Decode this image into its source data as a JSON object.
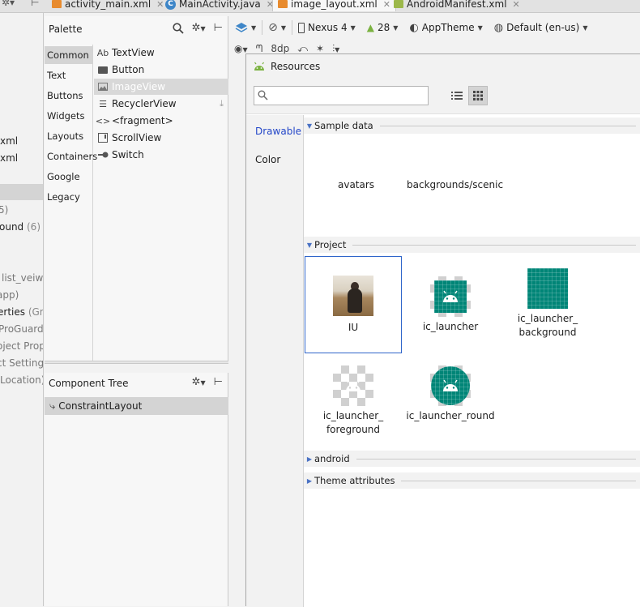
{
  "tabs": [
    {
      "label": "activity_main.xml",
      "icon": "layout-file-icon"
    },
    {
      "label": "MainActivity.java",
      "icon": "class-icon"
    },
    {
      "label": "image_layout.xml",
      "icon": "layout-file-icon",
      "active": true
    },
    {
      "label": "AndroidManifest.xml",
      "icon": "manifest-icon"
    }
  ],
  "left_tree": {
    "items": [
      "xml",
      "xml",
      "5)",
      "ound",
      "(6)",
      "list_veiw)",
      "app)",
      "erties",
      "(Grad",
      "ProGuard R",
      "oject Prope",
      "ct Settings",
      "Location)"
    ]
  },
  "palette": {
    "title": "Palette",
    "categories": [
      "Common",
      "Text",
      "Buttons",
      "Widgets",
      "Layouts",
      "Containers",
      "Google",
      "Legacy"
    ],
    "selected_category": "Common",
    "items": [
      {
        "label": "TextView",
        "icon": "Ab"
      },
      {
        "label": "Button",
        "icon": "button-icon"
      },
      {
        "label": "ImageView",
        "icon": "image-icon"
      },
      {
        "label": "RecyclerView",
        "icon": "list-icon"
      },
      {
        "label": "<fragment>",
        "icon": "<>"
      },
      {
        "label": "ScrollView",
        "icon": "scroll-icon"
      },
      {
        "label": "Switch",
        "icon": "switch-icon"
      }
    ],
    "selected_item": "ImageView"
  },
  "component_tree": {
    "title": "Component Tree",
    "root": "ConstraintLayout"
  },
  "design_toolbar": {
    "device": "Nexus 4",
    "api": "28",
    "theme": "AppTheme",
    "locale": "Default (en-us)",
    "margin": "8dp"
  },
  "resources": {
    "title": "Resources",
    "search_placeholder": "",
    "side_tabs": [
      "Drawable",
      "Color"
    ],
    "selected_side_tab": "Drawable",
    "sections": {
      "sample_data": "Sample data",
      "project": "Project",
      "android": "android",
      "theme_attributes": "Theme attributes"
    },
    "sample_items": [
      "avatars",
      "backgrounds/scenic"
    ],
    "project_items": [
      {
        "label": "IU",
        "kind": "photo"
      },
      {
        "label": "ic_launcher",
        "kind": "launcher"
      },
      {
        "label": "ic_launcher_\nbackground",
        "kind": "background"
      },
      {
        "label": "ic_launcher_\nforeground",
        "kind": "foreground"
      },
      {
        "label": "ic_launcher_round",
        "kind": "round"
      }
    ],
    "selected_project_item": "IU"
  },
  "colors": {
    "accent": "#2346c8",
    "teal": "#008577",
    "selection": "#d4d4d4"
  }
}
